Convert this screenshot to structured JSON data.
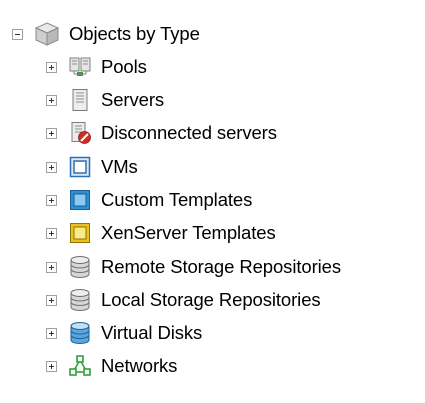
{
  "tree": {
    "root": {
      "label": "Objects by Type",
      "icon": "cube-icon",
      "expanded": true
    },
    "items": [
      {
        "label": "Pools",
        "icon": "pool-icon",
        "expanded": false
      },
      {
        "label": "Servers",
        "icon": "server-icon",
        "expanded": false
      },
      {
        "label": "Disconnected servers",
        "icon": "disconnected-server-icon",
        "expanded": false
      },
      {
        "label": "VMs",
        "icon": "vm-icon",
        "expanded": false
      },
      {
        "label": "Custom Templates",
        "icon": "custom-template-icon",
        "expanded": false
      },
      {
        "label": "XenServer Templates",
        "icon": "xenserver-template-icon",
        "expanded": false
      },
      {
        "label": "Remote Storage Repositories",
        "icon": "remote-storage-icon",
        "expanded": false
      },
      {
        "label": "Local Storage Repositories",
        "icon": "local-storage-icon",
        "expanded": false
      },
      {
        "label": "Virtual Disks",
        "icon": "virtual-disk-icon",
        "expanded": false
      },
      {
        "label": "Networks",
        "icon": "network-icon",
        "expanded": false
      }
    ]
  },
  "colors": {
    "vm_blue": "#2f6fb8",
    "custom_template_blue": "#2a8fd6",
    "xenserver_yellow": "#e8c21c",
    "disconnected_red": "#d52b1e",
    "network_green": "#2fa33a",
    "disk_blue": "#3a8fd0"
  }
}
